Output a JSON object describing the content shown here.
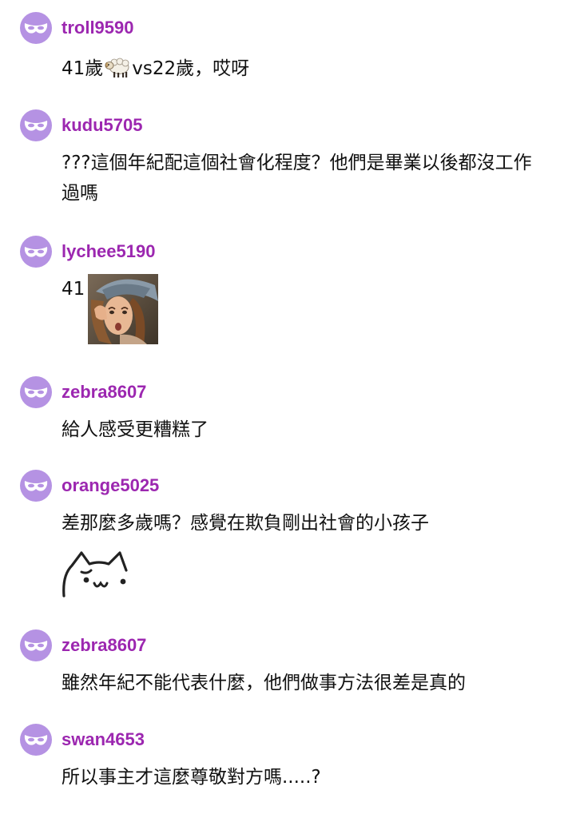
{
  "comments": [
    {
      "username": "troll9590",
      "text_before_emoji": "41歲",
      "emoji": "sheep-emoji",
      "text_after_emoji": "vs22歲，哎呀"
    },
    {
      "username": "kudu5705",
      "text": "???這個年紀配這個社會化程度？他們是畢業以後都沒工作過嗎"
    },
    {
      "username": "lychee5190",
      "text": "41",
      "image": "shocked-painting-sticker"
    },
    {
      "username": "zebra8607",
      "text": "給人感受更糟糕了"
    },
    {
      "username": "orange5025",
      "text": "差那麼多歲嗎？感覺在欺負剛出社會的小孩子",
      "image": "cat-doodle-sticker"
    },
    {
      "username": "zebra8607",
      "text": "雖然年紀不能代表什麼，他們做事方法很差是真的"
    },
    {
      "username": "swan4653",
      "text": "所以事主才這麼尊敬對方嗎.....?"
    }
  ],
  "colors": {
    "username": "#9c27b0",
    "avatar_bg": "#b592e3",
    "text": "#111111"
  },
  "avatar_icon": "mask-icon"
}
